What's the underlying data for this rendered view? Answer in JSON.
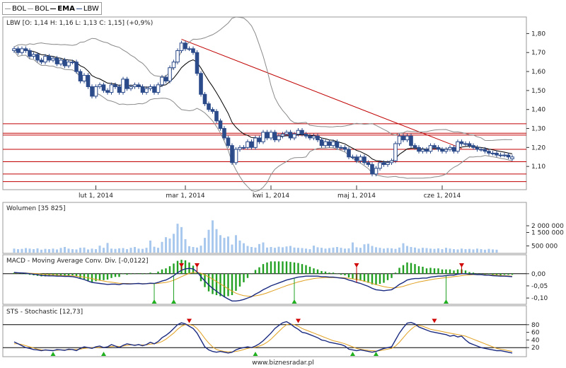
{
  "legend": [
    {
      "label": "BOL",
      "color": "#999999",
      "selected": false
    },
    {
      "label": "BOL",
      "color": "#999999",
      "selected": false
    },
    {
      "label": "EMA",
      "color": "#000000",
      "selected": true
    },
    {
      "label": "LBW",
      "color": "#2b4a8a",
      "selected": false
    }
  ],
  "footer": "www.biznesradar.pl",
  "chart_data": [
    {
      "type": "candlestick",
      "title": "LBW [O: 1,14  H: 1,16  L: 1,13  C: 1,15] (+0,9%)",
      "ylim": [
        1.0,
        1.85
      ],
      "yticks": [
        "1,80",
        "1,70",
        "1,60",
        "1,50",
        "1,40",
        "1,30",
        "1,20",
        "1,10"
      ],
      "ytick_values": [
        1.8,
        1.7,
        1.6,
        1.5,
        1.4,
        1.3,
        1.2,
        1.1
      ],
      "xtick_labels": [
        "lut 1, 2014",
        "mar 1, 2014",
        "kwi 1, 2014",
        "maj 1, 2014",
        "cze 1, 2014"
      ],
      "xtick_index": [
        21,
        44,
        66,
        88,
        110
      ],
      "close": [
        1.72,
        1.7,
        1.72,
        1.71,
        1.68,
        1.69,
        1.66,
        1.65,
        1.68,
        1.66,
        1.67,
        1.64,
        1.66,
        1.63,
        1.65,
        1.65,
        1.6,
        1.55,
        1.58,
        1.52,
        1.47,
        1.52,
        1.53,
        1.5,
        1.49,
        1.53,
        1.52,
        1.49,
        1.56,
        1.51,
        1.52,
        1.53,
        1.52,
        1.49,
        1.51,
        1.52,
        1.49,
        1.53,
        1.57,
        1.55,
        1.62,
        1.65,
        1.71,
        1.75,
        1.72,
        1.72,
        1.7,
        1.59,
        1.48,
        1.43,
        1.4,
        1.39,
        1.34,
        1.3,
        1.25,
        1.21,
        1.12,
        1.19,
        1.2,
        1.2,
        1.23,
        1.2,
        1.25,
        1.23,
        1.28,
        1.25,
        1.28,
        1.24,
        1.26,
        1.27,
        1.28,
        1.25,
        1.27,
        1.29,
        1.27,
        1.26,
        1.25,
        1.26,
        1.24,
        1.21,
        1.23,
        1.21,
        1.23,
        1.2,
        1.2,
        1.19,
        1.15,
        1.15,
        1.13,
        1.15,
        1.12,
        1.11,
        1.06,
        1.09,
        1.12,
        1.11,
        1.12,
        1.13,
        1.22,
        1.26,
        1.24,
        1.26,
        1.21,
        1.2,
        1.18,
        1.19,
        1.18,
        1.21,
        1.2,
        1.19,
        1.18,
        1.19,
        1.2,
        1.18,
        1.23,
        1.22,
        1.22,
        1.21,
        1.2,
        1.19,
        1.19,
        1.18,
        1.17,
        1.17,
        1.16,
        1.16,
        1.16,
        1.15,
        1.15
      ],
      "open": [
        1.71,
        1.72,
        1.7,
        1.72,
        1.71,
        1.68,
        1.69,
        1.66,
        1.65,
        1.68,
        1.66,
        1.67,
        1.64,
        1.66,
        1.63,
        1.65,
        1.65,
        1.6,
        1.55,
        1.58,
        1.52,
        1.47,
        1.52,
        1.53,
        1.5,
        1.49,
        1.53,
        1.52,
        1.49,
        1.56,
        1.51,
        1.52,
        1.53,
        1.52,
        1.49,
        1.51,
        1.52,
        1.49,
        1.53,
        1.57,
        1.55,
        1.62,
        1.65,
        1.71,
        1.75,
        1.72,
        1.72,
        1.7,
        1.59,
        1.48,
        1.43,
        1.4,
        1.39,
        1.34,
        1.3,
        1.25,
        1.21,
        1.12,
        1.19,
        1.2,
        1.2,
        1.23,
        1.2,
        1.25,
        1.23,
        1.28,
        1.25,
        1.28,
        1.24,
        1.26,
        1.27,
        1.28,
        1.25,
        1.27,
        1.29,
        1.27,
        1.26,
        1.25,
        1.26,
        1.24,
        1.21,
        1.23,
        1.21,
        1.23,
        1.2,
        1.2,
        1.19,
        1.15,
        1.15,
        1.13,
        1.15,
        1.12,
        1.11,
        1.06,
        1.09,
        1.12,
        1.11,
        1.12,
        1.13,
        1.22,
        1.26,
        1.24,
        1.26,
        1.21,
        1.2,
        1.18,
        1.19,
        1.18,
        1.21,
        1.2,
        1.19,
        1.18,
        1.19,
        1.2,
        1.18,
        1.23,
        1.22,
        1.22,
        1.21,
        1.2,
        1.19,
        1.19,
        1.18,
        1.17,
        1.17,
        1.16,
        1.16,
        1.16,
        1.14
      ],
      "resistance_levels": [
        1.325,
        1.275,
        1.265,
        1.19,
        1.125,
        1.06,
        1.02
      ],
      "trendline": [
        [
          43,
          1.77
        ],
        [
          115,
          1.195
        ]
      ]
    },
    {
      "type": "bar",
      "title": "Wolumen [35 825]",
      "ylim": [
        0,
        3000000
      ],
      "yticks": [
        "2 000 000",
        "1 500 000",
        "500 000"
      ],
      "ytick_values": [
        2000000,
        1500000,
        500000
      ],
      "values": [
        300000,
        260000,
        280000,
        340000,
        300000,
        260000,
        320000,
        220000,
        280000,
        260000,
        300000,
        240000,
        350000,
        420000,
        300000,
        260000,
        240000,
        360000,
        380000,
        240000,
        300000,
        260000,
        520000,
        360000,
        720000,
        300000,
        280000,
        320000,
        340000,
        260000,
        360000,
        420000,
        300000,
        280000,
        360000,
        900000,
        440000,
        360000,
        800000,
        1150000,
        1050000,
        1400000,
        2150000,
        1900000,
        1000000,
        480000,
        420000,
        380000,
        520000,
        1100000,
        1700000,
        2400000,
        1750000,
        1300000,
        1100000,
        1200000,
        600000,
        1300000,
        900000,
        700000,
        500000,
        420000,
        380000,
        640000,
        760000,
        380000,
        420000,
        360000,
        440000,
        400000,
        460000,
        500000,
        380000,
        360000,
        340000,
        300000,
        260000,
        520000,
        400000,
        360000,
        300000,
        340000,
        380000,
        420000,
        360000,
        300000,
        320000,
        760000,
        400000,
        360000,
        620000,
        660000,
        500000,
        400000,
        360000,
        300000,
        340000,
        320000,
        280000,
        380000,
        700000,
        500000,
        420000,
        380000,
        300000,
        360000,
        340000,
        300000,
        280000,
        320000,
        260000,
        360000,
        300000,
        260000,
        240000,
        300000,
        260000,
        280000,
        240000,
        300000,
        260000,
        220000,
        280000,
        240000,
        220000
      ]
    },
    {
      "type": "line",
      "title": "MACD - Moving Average Conv. Div. [-0,0122]",
      "ylim": [
        -0.12,
        0.04
      ],
      "yticks": [
        "0,00",
        "-0,05",
        "-0,10"
      ],
      "ytick_values": [
        0,
        -0.05,
        -0.1
      ],
      "macd": [
        0.005,
        0.004,
        0.003,
        0.002,
        0.0,
        -0.002,
        -0.004,
        -0.007,
        -0.008,
        -0.009,
        -0.009,
        -0.01,
        -0.01,
        -0.011,
        -0.011,
        -0.012,
        -0.015,
        -0.02,
        -0.024,
        -0.03,
        -0.036,
        -0.038,
        -0.04,
        -0.042,
        -0.044,
        -0.043,
        -0.043,
        -0.045,
        -0.041,
        -0.042,
        -0.042,
        -0.041,
        -0.04,
        -0.042,
        -0.041,
        -0.039,
        -0.04,
        -0.036,
        -0.03,
        -0.026,
        -0.018,
        -0.008,
        0.004,
        0.014,
        0.02,
        0.022,
        0.02,
        0.008,
        -0.012,
        -0.03,
        -0.046,
        -0.06,
        -0.072,
        -0.084,
        -0.095,
        -0.104,
        -0.112,
        -0.112,
        -0.11,
        -0.106,
        -0.1,
        -0.094,
        -0.084,
        -0.076,
        -0.066,
        -0.058,
        -0.05,
        -0.044,
        -0.038,
        -0.032,
        -0.026,
        -0.022,
        -0.018,
        -0.014,
        -0.012,
        -0.01,
        -0.01,
        -0.01,
        -0.01,
        -0.012,
        -0.012,
        -0.014,
        -0.014,
        -0.016,
        -0.018,
        -0.02,
        -0.026,
        -0.03,
        -0.036,
        -0.04,
        -0.046,
        -0.052,
        -0.06,
        -0.066,
        -0.068,
        -0.07,
        -0.068,
        -0.066,
        -0.056,
        -0.044,
        -0.036,
        -0.026,
        -0.022,
        -0.02,
        -0.02,
        -0.018,
        -0.018,
        -0.014,
        -0.012,
        -0.01,
        -0.01,
        -0.008,
        -0.006,
        -0.006,
        -0.002,
        0.0,
        0.0,
        -0.002,
        -0.002,
        -0.004,
        -0.004,
        -0.006,
        -0.006,
        -0.008,
        -0.009,
        -0.01,
        -0.01,
        -0.011,
        -0.012
      ],
      "signal": [
        0.003,
        0.003,
        0.003,
        0.003,
        0.002,
        0.001,
        0.0,
        -0.002,
        -0.003,
        -0.004,
        -0.005,
        -0.006,
        -0.007,
        -0.008,
        -0.008,
        -0.009,
        -0.01,
        -0.012,
        -0.014,
        -0.017,
        -0.02,
        -0.024,
        -0.027,
        -0.03,
        -0.033,
        -0.035,
        -0.037,
        -0.039,
        -0.04,
        -0.04,
        -0.041,
        -0.041,
        -0.041,
        -0.041,
        -0.041,
        -0.041,
        -0.041,
        -0.04,
        -0.038,
        -0.036,
        -0.032,
        -0.027,
        -0.02,
        -0.012,
        -0.005,
        0.001,
        0.005,
        0.006,
        0.002,
        -0.005,
        -0.013,
        -0.022,
        -0.032,
        -0.042,
        -0.052,
        -0.062,
        -0.072,
        -0.08,
        -0.086,
        -0.09,
        -0.092,
        -0.093,
        -0.091,
        -0.088,
        -0.084,
        -0.079,
        -0.073,
        -0.067,
        -0.061,
        -0.055,
        -0.049,
        -0.044,
        -0.039,
        -0.034,
        -0.03,
        -0.026,
        -0.023,
        -0.02,
        -0.018,
        -0.017,
        -0.016,
        -0.016,
        -0.016,
        -0.016,
        -0.016,
        -0.017,
        -0.019,
        -0.021,
        -0.024,
        -0.027,
        -0.031,
        -0.035,
        -0.04,
        -0.045,
        -0.049,
        -0.053,
        -0.056,
        -0.058,
        -0.058,
        -0.055,
        -0.052,
        -0.047,
        -0.042,
        -0.038,
        -0.034,
        -0.031,
        -0.028,
        -0.025,
        -0.022,
        -0.02,
        -0.018,
        -0.016,
        -0.014,
        -0.012,
        -0.01,
        -0.008,
        -0.006,
        -0.005,
        -0.004,
        -0.004,
        -0.004,
        -0.004,
        -0.005,
        -0.005,
        -0.006,
        -0.007,
        -0.008,
        -0.009,
        -0.01
      ],
      "sell_signals": [
        43,
        47,
        88,
        115
      ],
      "buy_signals": [
        36,
        41,
        72,
        111
      ]
    },
    {
      "type": "line",
      "title": "STS - Stochastic [12,73]",
      "ylim": [
        0,
        100
      ],
      "yticks": [
        "80",
        "60",
        "40",
        "20"
      ],
      "ytick_values": [
        80,
        60,
        40,
        20
      ],
      "k": [
        35,
        30,
        25,
        20,
        18,
        15,
        14,
        12,
        14,
        13,
        12,
        15,
        14,
        13,
        16,
        15,
        12,
        18,
        22,
        20,
        18,
        22,
        24,
        20,
        22,
        28,
        24,
        20,
        26,
        30,
        28,
        26,
        28,
        25,
        28,
        34,
        30,
        36,
        46,
        52,
        60,
        70,
        80,
        85,
        82,
        76,
        70,
        58,
        40,
        22,
        14,
        10,
        8,
        10,
        8,
        6,
        8,
        14,
        18,
        20,
        22,
        20,
        24,
        30,
        38,
        48,
        58,
        70,
        78,
        85,
        88,
        82,
        74,
        68,
        60,
        58,
        54,
        50,
        46,
        40,
        38,
        34,
        32,
        30,
        28,
        24,
        16,
        14,
        12,
        14,
        12,
        10,
        8,
        10,
        14,
        18,
        20,
        22,
        40,
        58,
        72,
        84,
        86,
        82,
        74,
        70,
        66,
        62,
        60,
        58,
        56,
        54,
        50,
        52,
        48,
        50,
        40,
        32,
        28,
        24,
        20,
        18,
        16,
        14,
        12,
        12,
        10,
        8,
        6
      ],
      "d": [
        30,
        30,
        28,
        25,
        22,
        19,
        16,
        14,
        13,
        13,
        13,
        13,
        14,
        14,
        14,
        15,
        15,
        16,
        18,
        19,
        20,
        20,
        21,
        21,
        22,
        23,
        24,
        23,
        24,
        26,
        27,
        27,
        27,
        27,
        27,
        29,
        30,
        32,
        36,
        42,
        50,
        58,
        68,
        76,
        80,
        80,
        78,
        70,
        58,
        44,
        32,
        22,
        15,
        12,
        10,
        9,
        9,
        10,
        12,
        15,
        18,
        20,
        21,
        24,
        28,
        34,
        42,
        52,
        62,
        72,
        80,
        82,
        80,
        76,
        70,
        66,
        62,
        58,
        54,
        50,
        46,
        42,
        38,
        36,
        33,
        30,
        26,
        22,
        18,
        16,
        14,
        13,
        12,
        11,
        12,
        14,
        16,
        18,
        24,
        34,
        46,
        58,
        68,
        76,
        78,
        76,
        72,
        68,
        66,
        64,
        62,
        60,
        58,
        56,
        54,
        52,
        50,
        46,
        42,
        38,
        34,
        30,
        26,
        22,
        18,
        16,
        14,
        12,
        10
      ],
      "sell_signals": [
        45,
        73,
        108
      ],
      "buy_signals": [
        10,
        23,
        62,
        87,
        93
      ]
    }
  ]
}
